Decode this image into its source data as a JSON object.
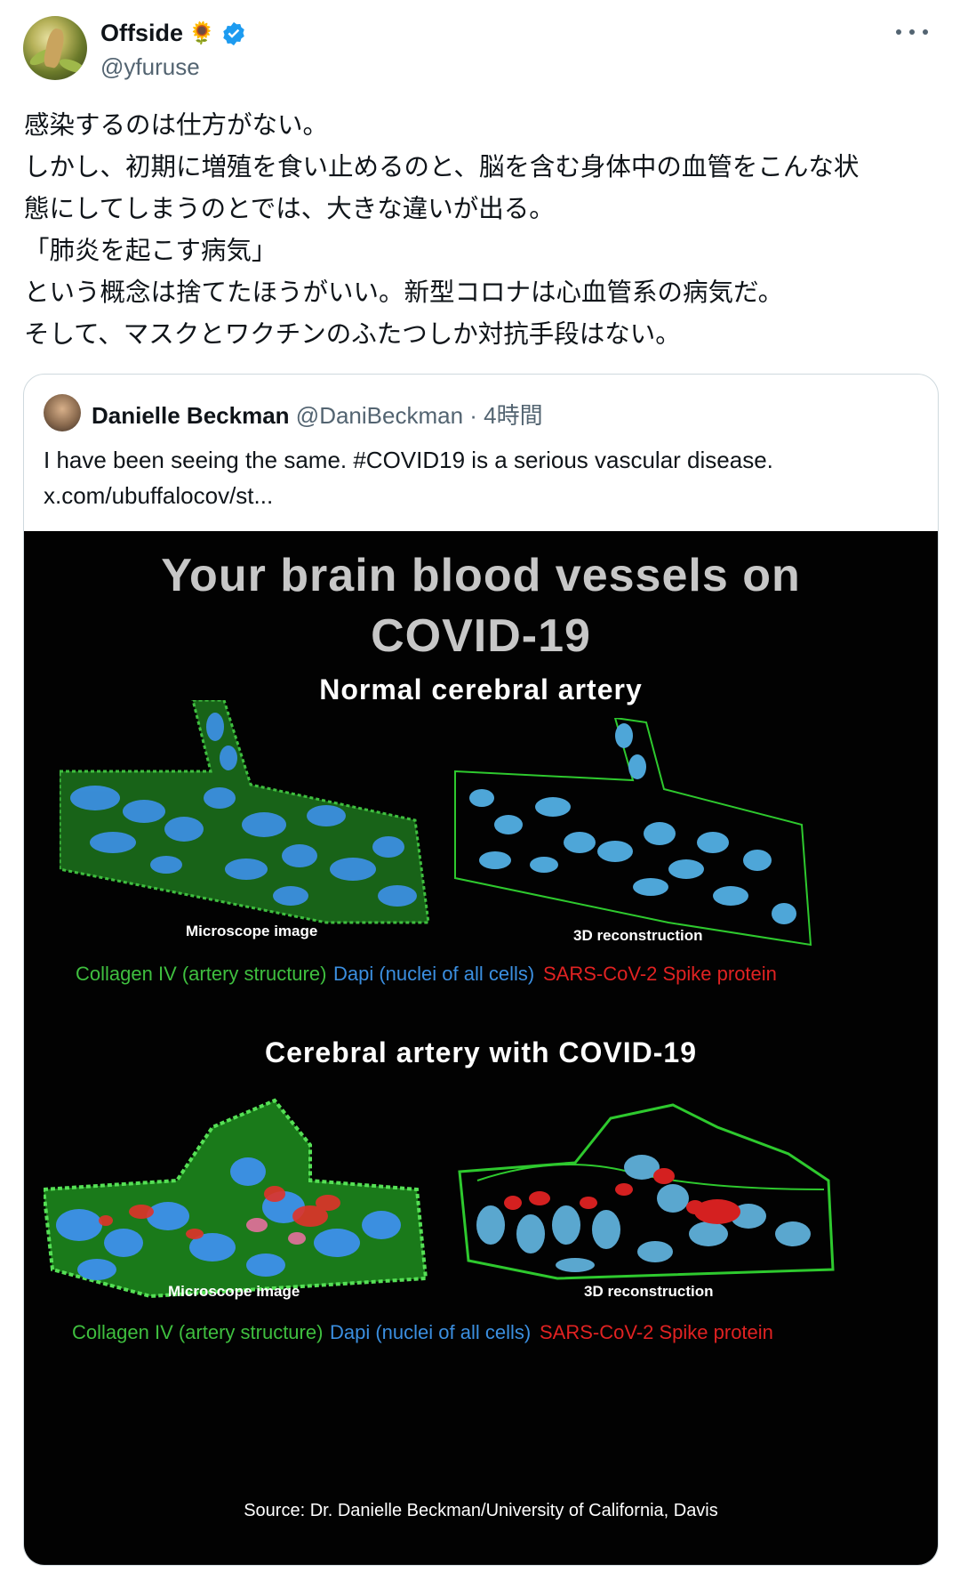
{
  "author": {
    "name": "Offside",
    "name_emoji": "🌻",
    "handle": "@yfuruse",
    "verified": true,
    "avatar_icon": "profile-photo"
  },
  "menu_icon": "more-horizontal-icon",
  "tweet_lines": [
    "感染するのは仕方がない。",
    "しかし、初期に増殖を食い止めるのと、脳を含む身体中の血管をこんな状",
    "態にしてしまうのとでは、大きな違いが出る。",
    "「肺炎を起こす病気」",
    "という概念は捨てたほうがいい。新型コロナは心血管系の病気だ。",
    "そして、マスクとワクチンのふたつしか対抗手段はない。"
  ],
  "quote": {
    "name": "Danielle Beckman",
    "handle": "@DaniBeckman",
    "separator": " · ",
    "time": "4時間",
    "text_line1": "I have been seeing the same. #COVID19 is a serious vascular disease.",
    "text_line2": "x.com/ubuffalocov/st...",
    "media": {
      "title_line1": "Your brain blood vessels on",
      "title_line2": "COVID-19",
      "section1_title": "Normal cerebral artery",
      "section2_title": "Cerebral artery with COVID-19",
      "caption_microscope": "Microscope image",
      "caption_3d": "3D reconstruction",
      "legend_collagen": "Collagen IV (artery structure)",
      "legend_dapi": "Dapi (nuclei of all cells)",
      "legend_spike": "SARS-CoV-2 Spike protein",
      "source": "Source: Dr. Danielle Beckman/University of California, Davis",
      "colors": {
        "collagen": "#3fbf3f",
        "dapi": "#3b8fe0",
        "spike": "#e02222",
        "title": "#c7c7c7"
      }
    }
  },
  "colors": {
    "verified": "#1d9bf0",
    "secondary_text": "#536471",
    "border": "#cfd9de"
  }
}
